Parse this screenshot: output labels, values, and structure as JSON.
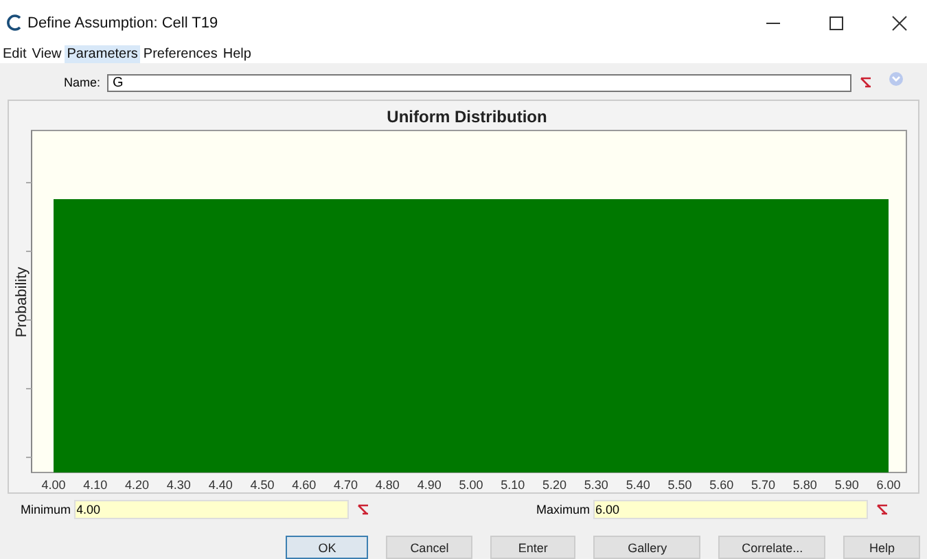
{
  "window": {
    "title": "Define Assumption: Cell T19"
  },
  "menu": [
    {
      "label": "Edit",
      "selected": false
    },
    {
      "label": "View",
      "selected": false
    },
    {
      "label": "Parameters",
      "selected": true
    },
    {
      "label": "Preferences",
      "selected": false
    },
    {
      "label": "Help",
      "selected": false
    }
  ],
  "name_field": {
    "label": "Name:",
    "value": "G"
  },
  "chart": {
    "title": "Uniform Distribution",
    "ylabel": "Probability",
    "x_ticks": [
      "4.00",
      "4.10",
      "4.20",
      "4.30",
      "4.40",
      "4.50",
      "4.60",
      "4.70",
      "4.80",
      "4.90",
      "5.00",
      "5.10",
      "5.20",
      "5.30",
      "5.40",
      "5.50",
      "5.60",
      "5.70",
      "5.80",
      "5.90",
      "6.00"
    ]
  },
  "parameters": [
    {
      "label": "Minimum",
      "value": "4.00"
    },
    {
      "label": "Maximum",
      "value": "6.00"
    }
  ],
  "buttons": [
    {
      "label": "OK",
      "selected": true
    },
    {
      "label": "Cancel",
      "selected": false
    },
    {
      "label": "Enter",
      "selected": false
    },
    {
      "label": "Gallery",
      "selected": false
    },
    {
      "label": "Correlate...",
      "selected": false
    },
    {
      "label": "Help",
      "selected": false
    }
  ]
}
